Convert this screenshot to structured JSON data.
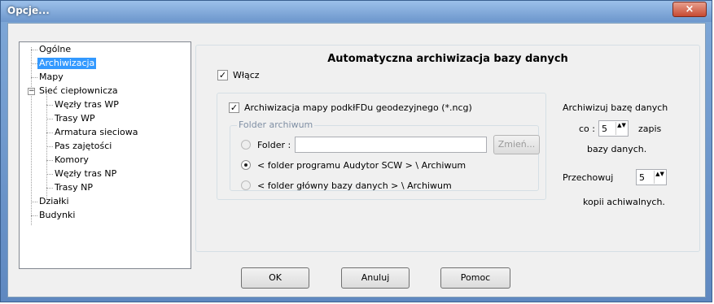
{
  "window": {
    "title": "Opcje...",
    "close_label": "×"
  },
  "tree": {
    "items": [
      {
        "label": "Ogólne"
      },
      {
        "label": "Archiwizacja"
      },
      {
        "label": "Mapy"
      },
      {
        "label": "Sieć ciepłownicza",
        "expander": "−"
      },
      {
        "label": "Węzły tras WP"
      },
      {
        "label": "Trasy WP"
      },
      {
        "label": "Armatura sieciowa"
      },
      {
        "label": "Pas zajętości"
      },
      {
        "label": "Komory"
      },
      {
        "label": "Węzły tras NP"
      },
      {
        "label": "Trasy NP"
      },
      {
        "label": "Działki"
      },
      {
        "label": "Budynki"
      }
    ],
    "selected": "Archiwizacja"
  },
  "panel": {
    "title": "Automatyczna archiwizacja bazy danych",
    "enable_label": "Włącz",
    "enable_checked": "✓",
    "archive_map_label": "Archiwizacja mapy podkłFDu geodezyjnego (*.ncg)",
    "archive_map_checked": "✓",
    "folder_group": {
      "legend": "Folder archiwum",
      "folder_label": "Folder :",
      "folder_value": "",
      "change_button": "Zmień...",
      "option_program": "< folder programu Audytor SCW > \\ Archiwum",
      "option_db": "< folder główny bazy danych > \\ Archiwum"
    },
    "schedule": {
      "line1": "Archiwizuj bazę danych",
      "co_label": "co :",
      "co_value": "5",
      "zapis": "zapis",
      "line3": "bazy danych.",
      "keep_label": "Przechowuj",
      "keep_value": "5",
      "copies": "kopii achiwalnych.",
      "spin_arrows": "▲▼"
    }
  },
  "buttons": {
    "ok": "OK",
    "cancel": "Anuluj",
    "help": "Pomoc"
  }
}
